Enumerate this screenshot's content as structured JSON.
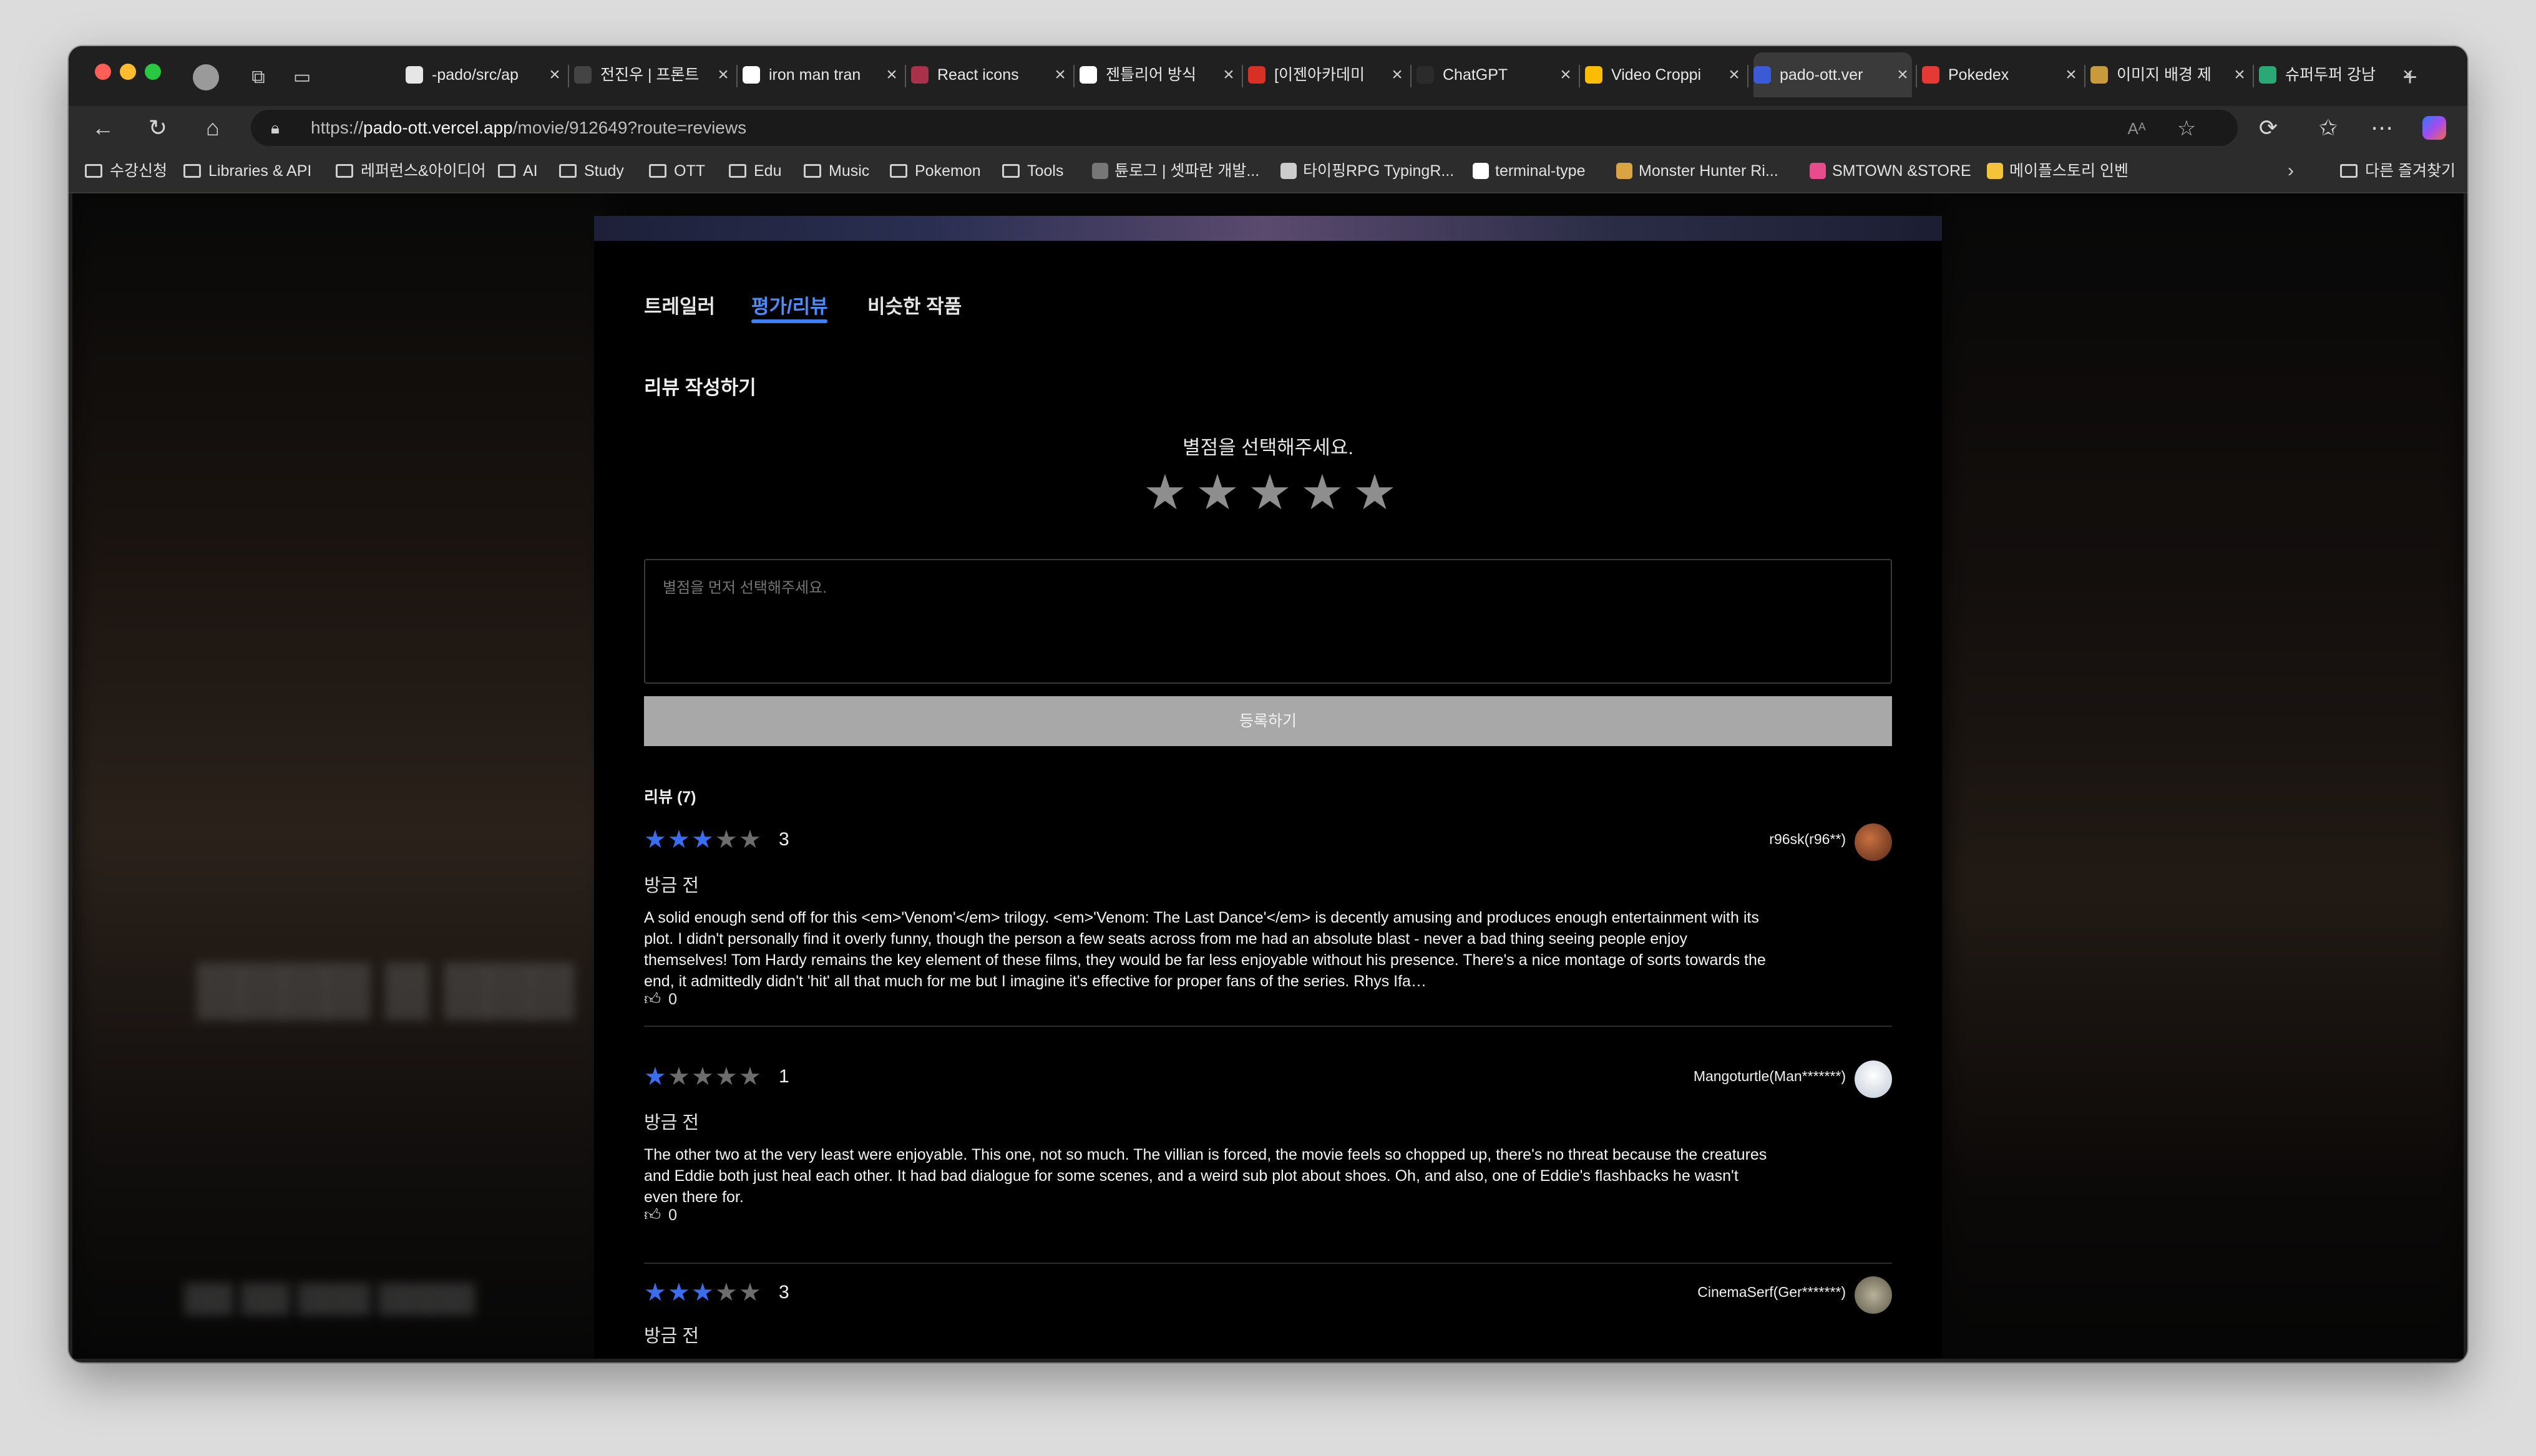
{
  "browser": {
    "tabs": [
      {
        "label": "-pado/src/ap",
        "favicon": "github-icon",
        "color": "#e6e6e6"
      },
      {
        "label": "전진우 | 프론트",
        "favicon": "notion-icon",
        "color": "#444444"
      },
      {
        "label": "iron man tran",
        "favicon": "google-icon",
        "color": "#ffffff"
      },
      {
        "label": "React icons",
        "favicon": "react-icons-icon",
        "color": "#a8324a"
      },
      {
        "label": "젠틀리어 방식",
        "favicon": "google-icon",
        "color": "#ffffff"
      },
      {
        "label": "[이젠아카데미",
        "favicon": "gmail-icon",
        "color": "#d93025"
      },
      {
        "label": "ChatGPT",
        "favicon": "chatgpt-icon",
        "color": "#2b2b2b"
      },
      {
        "label": "Video Croppi",
        "favicon": "google-apps-icon",
        "color": "#fbbc04"
      },
      {
        "label": "pado-ott.ver",
        "favicon": "pado-icon",
        "color": "#3b5bd6"
      },
      {
        "label": "Pokedex",
        "favicon": "pokedex-icon",
        "color": "#e53935"
      },
      {
        "label": "이미지 배경 제",
        "favicon": "image-tool-icon",
        "color": "#c79a3b"
      },
      {
        "label": "슈퍼두퍼 강남",
        "favicon": "superduper-icon",
        "color": "#2aa876"
      }
    ],
    "active_tab_index": 8,
    "url_prefix": "https://",
    "url_host": "pado-ott.vercel.app",
    "url_path": "/movie/912649?route=reviews",
    "bookmarks": [
      {
        "label": "수강신청",
        "type": "folder"
      },
      {
        "label": "Libraries & API",
        "type": "folder"
      },
      {
        "label": "레퍼런스&아이디어",
        "type": "folder"
      },
      {
        "label": "AI",
        "type": "folder"
      },
      {
        "label": "Study",
        "type": "folder"
      },
      {
        "label": "OTT",
        "type": "folder"
      },
      {
        "label": "Edu",
        "type": "folder"
      },
      {
        "label": "Music",
        "type": "folder"
      },
      {
        "label": "Pokemon",
        "type": "folder"
      },
      {
        "label": "Tools",
        "type": "folder"
      },
      {
        "label": "튠로그 | 셋파란 개발...",
        "type": "site"
      },
      {
        "label": "타이핑RPG TypingR...",
        "type": "site"
      },
      {
        "label": "terminal-type",
        "type": "site"
      },
      {
        "label": "Monster Hunter Ri...",
        "type": "site"
      },
      {
        "label": "SMTOWN &STORE",
        "type": "site"
      },
      {
        "label": "메이플스토리 인벤",
        "type": "site"
      }
    ],
    "other_bookmarks": "다른 즐겨찾기"
  },
  "page": {
    "tabs": [
      "트레일러",
      "평가/리뷰",
      "비슷한 작품"
    ],
    "selected_tab": 1,
    "write_title": "리뷰 작성하기",
    "rating_prompt": "별점을 선택해주세요.",
    "review_placeholder": "별점을 먼저 선택해주세요.",
    "submit_label": "등록하기",
    "review_count_label": "리뷰 (7)",
    "accent_color": "#3b6df0",
    "reviews": [
      {
        "rating": 3,
        "score": "3",
        "time": "방금 전",
        "user": "r96sk(r96**)",
        "text": "A solid enough send off for this <em>'Venom'</em> trilogy. <em>'Venom: The Last Dance'</em> is decently amusing and produces enough entertainment with its plot. I didn't personally find it overly funny, though the person a few seats across from me had an absolute blast - never a bad thing seeing people enjoy themselves! Tom Hardy remains the key element of these films, they would be far less enjoyable without his presence. There's a nice montage of sorts towards the end, it admittedly didn't 'hit' all that much for me but I imagine it's effective for proper fans of the series. Rhys Ifa…",
        "likes": "0"
      },
      {
        "rating": 1,
        "score": "1",
        "time": "방금 전",
        "user": "Mangoturtle(Man*******)",
        "text": "The other two at the very least were enjoyable. This one, not so much. The villian is forced, the movie feels so chopped up, there's no threat because the creatures and Eddie both just heal each other. It had bad dialogue for some scenes, and a weird sub plot about shoes. Oh, and also, one of Eddie's flashbacks he wasn't even there for.",
        "likes": "0"
      },
      {
        "rating": 3,
        "score": "3",
        "time": "방금 전",
        "user": "CinemaSerf(Ger*******)",
        "text": "",
        "likes": ""
      }
    ]
  }
}
